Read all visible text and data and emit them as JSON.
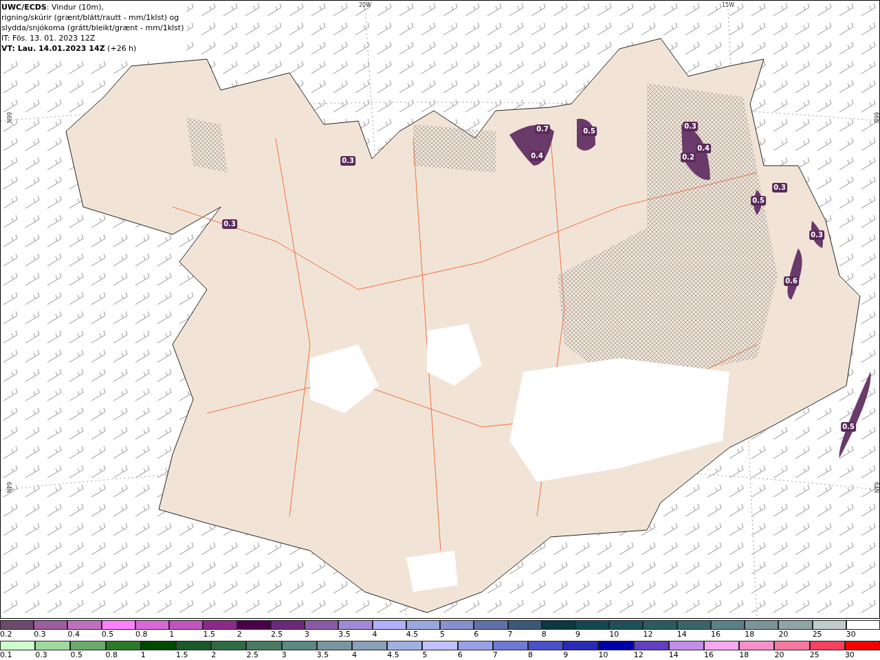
{
  "header": {
    "lines": [
      "**UWC/ECDS**: Vindur (10m),",
      "rigning/skúrir (grænt/blátt/rautt - mm/1klst) og",
      "slydda/snjókoma (grátt/bleikt/grænt - mm/1klst)",
      "IT: Fös. 13. 01. 2023 12Z",
      "**VT: Lau. 14.01.2023 14Z** (+26 h)"
    ]
  },
  "map": {
    "longitude_labels": [
      "20W",
      "15W"
    ],
    "latitude_labels_left": [
      "66N",
      "64N"
    ],
    "latitude_labels_right": [
      "66N",
      "64N"
    ],
    "contour_labels": [
      "0.3",
      "0.3",
      "0.7",
      "0.5",
      "0.4",
      "0.3",
      "0.4",
      "0.2",
      "0.5",
      "0.3",
      "0.3",
      "0.6",
      "0.5"
    ]
  },
  "legend": {
    "snow": [
      {
        "label": "0.2",
        "color": "#6b4a6b"
      },
      {
        "label": "0.3",
        "color": "#9c5e9c"
      },
      {
        "label": "0.4",
        "color": "#c070c0"
      },
      {
        "label": "0.5",
        "color": "#ff80ff"
      },
      {
        "label": "0.8",
        "color": "#d868d8"
      },
      {
        "label": "1",
        "color": "#c055c0"
      },
      {
        "label": "1.5",
        "color": "#8a2a8a"
      },
      {
        "label": "2",
        "color": "#4a004a"
      },
      {
        "label": "2.5",
        "color": "#6a2a7a"
      },
      {
        "label": "3",
        "color": "#8a5aa8"
      },
      {
        "label": "3.5",
        "color": "#a08ad8"
      },
      {
        "label": "4",
        "color": "#b0b0ff"
      },
      {
        "label": "4.5",
        "color": "#9aa8e0"
      },
      {
        "label": "5",
        "color": "#8890d0"
      },
      {
        "label": "6",
        "color": "#6070a8"
      },
      {
        "label": "7",
        "color": "#3a5878"
      },
      {
        "label": "8",
        "color": "#0a3a40"
      },
      {
        "label": "9",
        "color": "#144850"
      },
      {
        "label": "10",
        "color": "#1e5058"
      },
      {
        "label": "12",
        "color": "#2a5c60"
      },
      {
        "label": "14",
        "color": "#3a6468"
      },
      {
        "label": "16",
        "color": "#5a8088"
      },
      {
        "label": "18",
        "color": "#7a9498"
      },
      {
        "label": "20",
        "color": "#8fa4a4"
      },
      {
        "label": "25",
        "color": "#c0cccc"
      },
      {
        "label": "30",
        "color": "#ffffff"
      }
    ],
    "rain": [
      {
        "label": "0.1",
        "color": "#ccffcc"
      },
      {
        "label": "0.3",
        "color": "#a0d8a0"
      },
      {
        "label": "0.5",
        "color": "#6aaa6a"
      },
      {
        "label": "0.8",
        "color": "#2a7a2a"
      },
      {
        "label": "1",
        "color": "#004a00"
      },
      {
        "label": "1.5",
        "color": "#1a5a2a"
      },
      {
        "label": "2",
        "color": "#2e6a44"
      },
      {
        "label": "2.5",
        "color": "#4a7a64"
      },
      {
        "label": "3",
        "color": "#5a8a80"
      },
      {
        "label": "3.5",
        "color": "#7a96a0"
      },
      {
        "label": "4",
        "color": "#8aa0b8"
      },
      {
        "label": "4.5",
        "color": "#a0b0e0"
      },
      {
        "label": "5",
        "color": "#c0c0ff"
      },
      {
        "label": "6",
        "color": "#9aa0e8"
      },
      {
        "label": "7",
        "color": "#7078d8"
      },
      {
        "label": "8",
        "color": "#4a50c8"
      },
      {
        "label": "9",
        "color": "#2a2ab8"
      },
      {
        "label": "10",
        "color": "#0000a8"
      },
      {
        "label": "12",
        "color": "#6040c0"
      },
      {
        "label": "14",
        "color": "#c090e8"
      },
      {
        "label": "16",
        "color": "#f8a8f0"
      },
      {
        "label": "18",
        "color": "#f890c8"
      },
      {
        "label": "20",
        "color": "#f878a0"
      },
      {
        "label": "25",
        "color": "#f84060"
      },
      {
        "label": "30",
        "color": "#f80000"
      }
    ]
  }
}
